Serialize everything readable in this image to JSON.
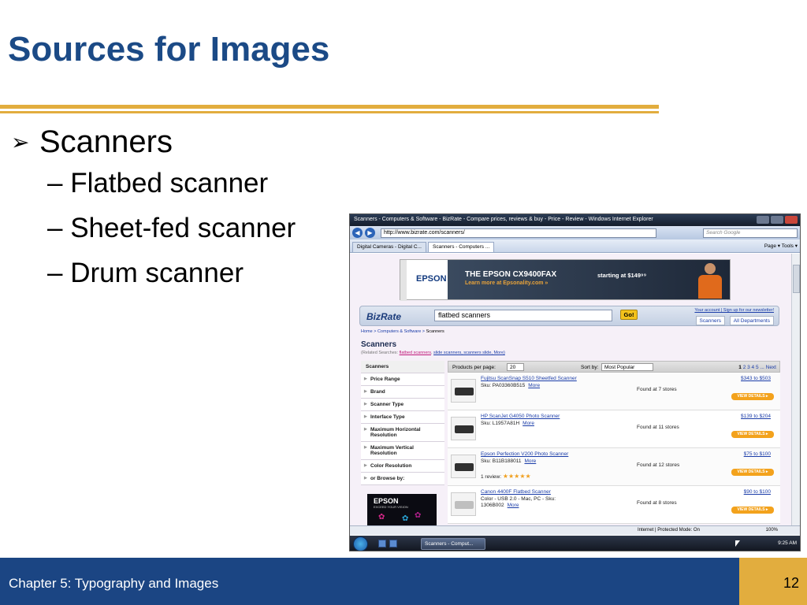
{
  "slide": {
    "title": "Sources for Images",
    "bullet": "Scanners",
    "sub_bullets": [
      "– Flatbed scanner",
      "– Sheet-fed scanner",
      "– Drum scanner"
    ],
    "footer": "Chapter 5: Typography and Images",
    "page_number": "12",
    "colors": {
      "title": "#1b4a86",
      "rule": "#e2ad3e",
      "footer_bg": "#1b4583"
    }
  },
  "browser": {
    "window_title": "Scanners - Computers & Software - BizRate - Compare prices, reviews & buy - Price - Review - Windows Internet Explorer",
    "url": "http://www.bizrate.com/scanners/",
    "search_placeholder": "Search Google",
    "tabs": [
      "Digital Cameras - Digital C...",
      "Scanners - Computers ..."
    ],
    "commands": "Page ▾  Tools ▾",
    "status_zone": "Internet | Protected Mode: On",
    "zoom": "100%",
    "taskbar_item": "Scanners - Comput...",
    "clock": "9:25 AM"
  },
  "ad": {
    "side_label": "Advertisement",
    "brand": "EPSON",
    "headline": "THE EPSON CX9400FAX",
    "subline": "Learn more at Epsonality.com »",
    "price": "starting at $149⁹⁹"
  },
  "bizrate": {
    "logo": "BizRate",
    "query": "flatbed scanners",
    "go": "Go!",
    "account_links": "Your account | Sign up for our newsletter!",
    "scope_tabs": [
      "Scanners",
      "All Departments"
    ],
    "breadcrumb": [
      "Home",
      "Computers & Software",
      "Scanners"
    ],
    "page_title": "Scanners",
    "related_label": "(Related Searches:",
    "related_hot": "flatbed scanners",
    "related_links": "slide scanners, scanners slide, More)",
    "facets_header": "Scanners",
    "facets": [
      "Price Range",
      "Brand",
      "Scanner Type",
      "Interface Type",
      "Maximum Horizontal Resolution",
      "Maximum Vertical Resolution",
      "Color Resolution",
      "or Browse by:"
    ],
    "promo_logo": "EPSON",
    "promo_sub": "EXCEED YOUR VISION",
    "per_page_label": "Products per page:",
    "per_page_value": "20",
    "sort_label": "Sort by:",
    "sort_value": "Most Popular",
    "pagination": {
      "current": "1",
      "others": "2 3 4 5 ... Next"
    },
    "products": [
      {
        "name": "Fujitsu ScanSnap S510 Sheetfed Scanner",
        "sku": "Sku: PA03360B515",
        "more": "More",
        "found": "Found at 7 stores",
        "price": "$343 to $503",
        "button": "VIEW DETAILS ▸",
        "review": ""
      },
      {
        "name": "HP ScanJet G4050 Photo Scanner",
        "sku": "Sku: L1957A81H",
        "more": "More",
        "found": "Found at 11 stores",
        "price": "$139 to $204",
        "button": "VIEW DETAILS ▸",
        "review": ""
      },
      {
        "name": "Epson Perfection V200 Photo Scanner",
        "sku": "Sku: B11B188011",
        "more": "More",
        "found": "Found at 12 stores",
        "price": "$75 to $100",
        "button": "VIEW DETAILS ▸",
        "review": "1 review:"
      },
      {
        "name": "Canon 4400F Flatbed Scanner",
        "sku": "Color - USB 2.0 - Mac, PC - Sku: 1306B002",
        "more": "More",
        "found": "Found at 8 stores",
        "price": "$90 to $100",
        "button": "VIEW DETAILS ▸",
        "review": ""
      }
    ],
    "rating_stars": "★★★★★"
  }
}
